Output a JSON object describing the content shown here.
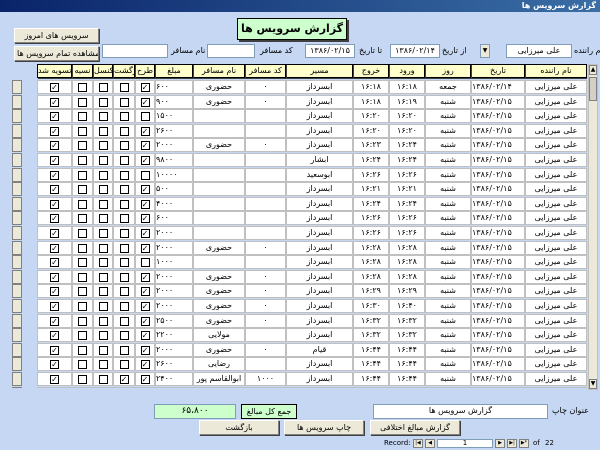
{
  "window": {
    "title": "گزارش سرویس ها"
  },
  "header": {
    "report_title": "گزارش سرویس ها",
    "today_button": "سرویس های امروز",
    "show_all_button": "مشاهده تمام سرویس ها",
    "driver_label": "نام راننده",
    "driver_value": "علی میرزایی",
    "from_date_label": "از تاریخ",
    "from_date_value": "۱۳۸۶/۰۲/۱۴",
    "to_date_label": "تا تاریخ",
    "to_date_value": "۱۳۸۶/۰۲/۱۵",
    "passenger_code_label": "کد مسافر",
    "passenger_code_value": "",
    "passenger_name_label": "نام مسافر",
    "passenger_name_value": ""
  },
  "columns": [
    "نام راننده",
    "تاریخ",
    "روز",
    "ورود",
    "خروج",
    "مسیر",
    "کد مسافر",
    "نام مسافر",
    "مبلغ",
    "طرح",
    "برگشت",
    "کنسل",
    "نسیه",
    "تسویه شد"
  ],
  "rows": [
    [
      "علی میرزایی",
      "۱۳۸۶/۰۲/۱۴",
      "جمعه",
      "۱۶:۱۸",
      "۱۶:۱۸",
      "ابسرداز",
      "۰",
      "حضوری",
      "۶۰۰",
      1,
      0,
      0,
      0,
      1
    ],
    [
      "علی میرزایی",
      "۱۳۸۶/۰۲/۱۵",
      "شنبه",
      "۱۶:۱۹",
      "۱۶:۱۸",
      "ابسرداز",
      "۰",
      "حضوری",
      "۹۰۰",
      1,
      0,
      0,
      0,
      1
    ],
    [
      "علی میرزایی",
      "۱۳۸۶/۰۲/۱۵",
      "شنبه",
      "۱۶:۲۰",
      "۱۶:۲۰",
      "ابسرداز",
      "",
      "",
      "۱۵۰۰",
      0,
      0,
      0,
      0,
      1
    ],
    [
      "علی میرزایی",
      "۱۳۸۶/۰۲/۱۵",
      "شنبه",
      "۱۶:۲۰",
      "۱۶:۲۰",
      "ابسرداز",
      "",
      "",
      "۲۶۰۰",
      1,
      0,
      0,
      0,
      1
    ],
    [
      "علی میرزایی",
      "۱۳۸۶/۰۲/۱۵",
      "شنبه",
      "۱۶:۲۴",
      "۱۶:۲۳",
      "ابسرداز",
      "۰",
      "حضوری",
      "۲۰۰۰",
      1,
      0,
      0,
      0,
      1
    ],
    [
      "علی میرزایی",
      "۱۳۸۶/۰۲/۱۵",
      "شنبه",
      "۱۶:۲۴",
      "۱۶:۲۴",
      "ابشار",
      "",
      "",
      "۹۸۰۰",
      1,
      0,
      0,
      0,
      1
    ],
    [
      "علی میرزایی",
      "۱۳۸۶/۰۲/۱۵",
      "شنبه",
      "۱۶:۲۶",
      "۱۶:۲۶",
      "ابوسعید",
      "",
      "",
      "۱۰۰۰۰",
      0,
      0,
      0,
      0,
      1
    ],
    [
      "علی میرزایی",
      "۱۳۸۶/۰۲/۱۵",
      "شنبه",
      "۱۶:۲۱",
      "۱۶:۲۱",
      "ابسرداز",
      "",
      "",
      "۵۰۰",
      1,
      0,
      0,
      0,
      1
    ],
    [
      "علی میرزایی",
      "۱۳۸۶/۰۲/۱۵",
      "شنبه",
      "۱۶:۲۴",
      "۱۶:۲۴",
      "ابسرداز",
      "",
      "",
      "۴۰۰۰",
      1,
      0,
      0,
      0,
      1
    ],
    [
      "علی میرزایی",
      "۱۳۸۶/۰۲/۱۵",
      "شنبه",
      "۱۶:۲۶",
      "۱۶:۲۶",
      "ابسرداز",
      "",
      "",
      "۶۰۰",
      1,
      0,
      0,
      0,
      1
    ],
    [
      "علی میرزایی",
      "۱۳۸۶/۰۲/۱۵",
      "شنبه",
      "۱۶:۲۶",
      "۱۶:۲۶",
      "ابسرداز",
      "",
      "",
      "۲۰۰۰",
      1,
      0,
      0,
      0,
      1
    ],
    [
      "علی میرزایی",
      "۱۳۸۶/۰۲/۱۵",
      "شنبه",
      "۱۶:۲۸",
      "۱۶:۲۸",
      "ابسرداز",
      "۰",
      "حضوری",
      "۲۰۰۰",
      1,
      0,
      0,
      0,
      1
    ],
    [
      "علی میرزایی",
      "۱۳۸۶/۰۲/۱۵",
      "شنبه",
      "۱۶:۲۸",
      "۱۶:۲۸",
      "ابسرداز",
      "",
      "",
      "۱۰۰۰",
      0,
      0,
      0,
      0,
      1
    ],
    [
      "علی میرزایی",
      "۱۳۸۶/۰۲/۱۵",
      "شنبه",
      "۱۶:۲۸",
      "۱۶:۲۸",
      "ابسرداز",
      "۰",
      "حضوری",
      "۲۰۰۰",
      1,
      0,
      0,
      0,
      1
    ],
    [
      "علی میرزایی",
      "۱۳۸۶/۰۲/۱۵",
      "شنبه",
      "۱۶:۲۹",
      "۱۶:۲۹",
      "ابسرداز",
      "۰",
      "حضوری",
      "۲۰۰۰",
      1,
      0,
      0,
      0,
      1
    ],
    [
      "علی میرزایی",
      "۱۳۸۶/۰۲/۱۵",
      "شنبه",
      "۱۶:۴۰",
      "۱۶:۳۰",
      "ابسرداز",
      "۰",
      "حضوری",
      "۲۰۰۰",
      1,
      0,
      0,
      0,
      1
    ],
    [
      "علی میرزایی",
      "۱۳۸۶/۰۲/۱۵",
      "شنبه",
      "۱۶:۳۲",
      "۱۶:۳۲",
      "ابسرداز",
      "۰",
      "حضوری",
      "۲۵۰۰",
      1,
      0,
      0,
      0,
      1
    ],
    [
      "علی میرزایی",
      "۱۳۸۶/۰۲/۱۵",
      "شنبه",
      "۱۶:۳۲",
      "۱۶:۳۲",
      "ابسرداز",
      "",
      "مولایی",
      "۲۲۰۰",
      1,
      0,
      0,
      0,
      1
    ],
    [
      "علی میرزایی",
      "۱۳۸۶/۰۲/۱۵",
      "شنبه",
      "۱۶:۴۴",
      "۱۶:۴۴",
      "قیام",
      "۰",
      "حضوری",
      "۲۰۰۰",
      1,
      0,
      0,
      0,
      1
    ],
    [
      "علی میرزایی",
      "۱۳۸۶/۰۲/۱۵",
      "شنبه",
      "۱۶:۴۴",
      "۱۶:۴۴",
      "ابسرداز",
      "",
      "رضایی",
      "۲۶۰۰",
      1,
      0,
      0,
      0,
      1
    ],
    [
      "علی میرزایی",
      "۱۳۸۶/۰۲/۱۵",
      "شنبه",
      "۱۶:۴۴",
      "۱۶:۴۴",
      "ابسرداز",
      "۱۰۰۰",
      "ابوالقاسم پور",
      "۲۴۰۰",
      1,
      1,
      0,
      0,
      1
    ],
    [
      "علی میرزایی",
      "۱۳۸۶/۰۲/۱۵",
      "شنبه",
      "۲۱:۱۴",
      "۲۱:۱۴",
      "ابسرداز",
      "۱۰۰۰",
      "ابوالقاسم پور",
      "۲۲۰۰",
      0,
      0,
      0,
      0,
      1
    ]
  ],
  "footer": {
    "print_title_label": "عنوان چاپ",
    "print_title_value": "گزارش سرویس ها",
    "total_label": "جمع کل مبالغ",
    "total_value": "۶۵،۸۰۰",
    "diff_report_button": "گزارش مبالغ اختلافی",
    "print_button": "چاپ سرویس ها",
    "back_button": "بازگشت"
  },
  "navigation": {
    "record_label": "Record:",
    "current": "1",
    "of_label": "of",
    "total": "22"
  }
}
